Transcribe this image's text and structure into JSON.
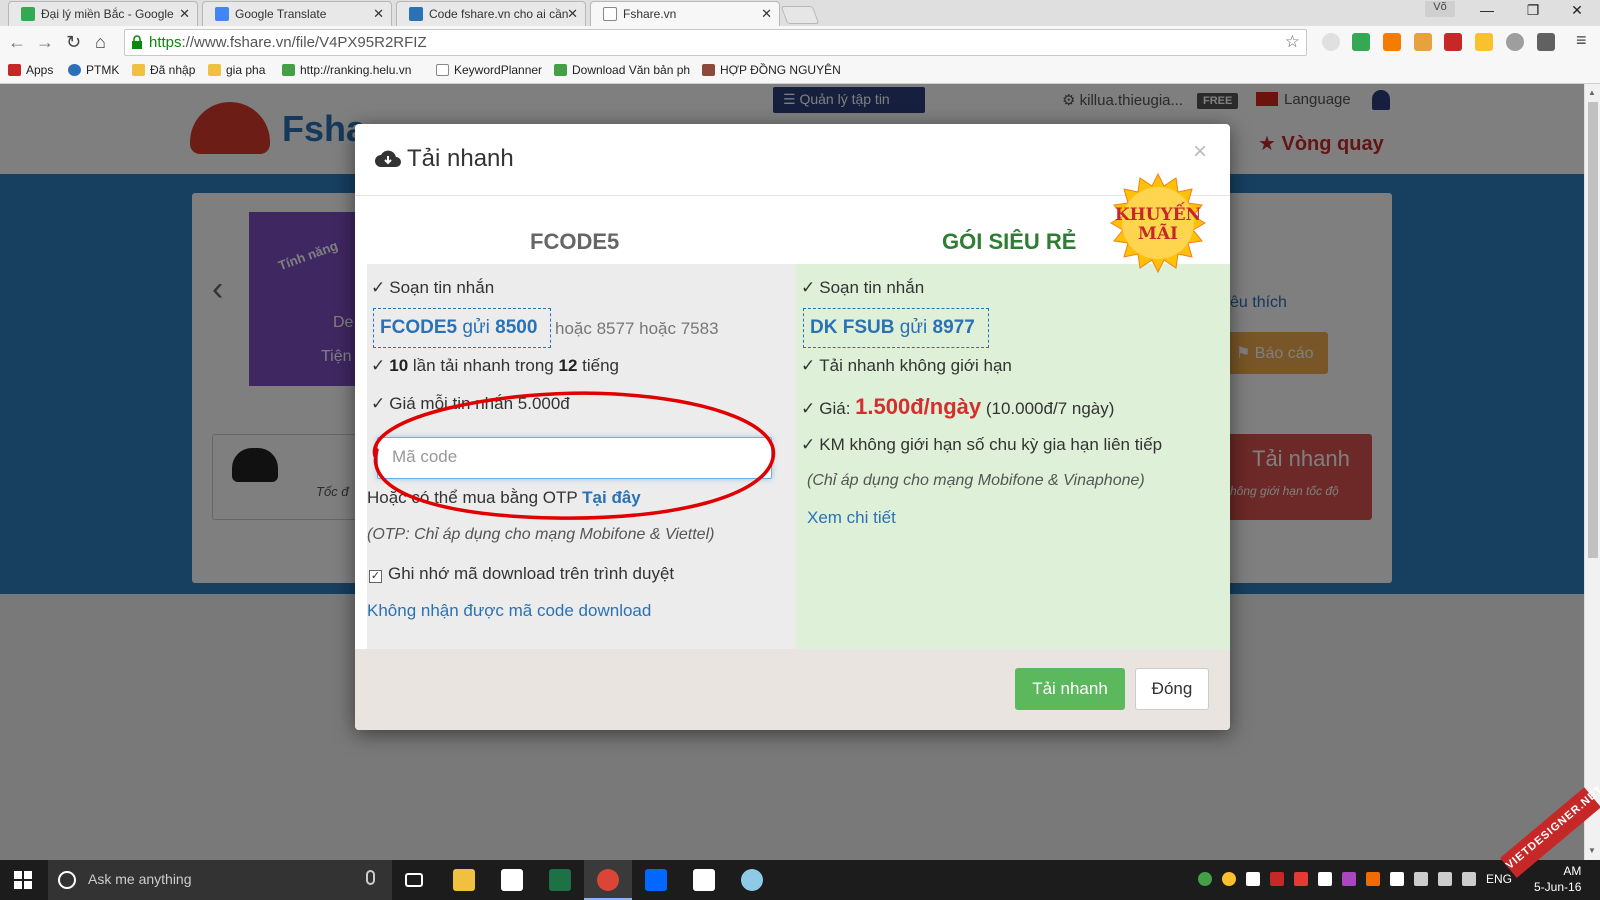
{
  "browser": {
    "tabs": [
      {
        "title": "Đại lý miền Bắc - Google",
        "favicon_color": "#34a853"
      },
      {
        "title": "Google Translate",
        "favicon_color": "#4285f4"
      },
      {
        "title": "Code fshare.vn cho ai cần",
        "favicon_color": "#2a72b5"
      },
      {
        "title": "Fshare.vn",
        "favicon_color": "#ffffff"
      }
    ],
    "user_chip": "Võ",
    "url_scheme": "https",
    "url_rest": "://www.fshare.vn/file/V4PX95R2RFIZ",
    "bookmarks": [
      "Apps",
      "PTMK",
      "Đã nhập",
      "gia pha",
      "http://ranking.helu.vn",
      "KeywordPlanner",
      "Download Văn bản ph",
      "HỢP ĐỒNG NGUYÊN"
    ]
  },
  "site": {
    "logo_text": "Fsha",
    "manage_files": "☰ Quản lý tập tin",
    "username": "killua.thieugia...",
    "plan_badge": "FREE",
    "language": "Language",
    "spin": "★ Vòng quay",
    "favorite_link": "êu thích",
    "report_button": "⚑ Báo cáo",
    "fast_download": "Tải nhanh",
    "fast_download_sub": "hông giới hạn tốc độ",
    "speed_text": "Tốc đ",
    "banner_text_1": "Tính năng",
    "banner_text_2": "De",
    "banner_text_3": "Tiện"
  },
  "modal": {
    "title": "Tải nhanh",
    "close": "×",
    "promo_line1": "KHUYẾN",
    "promo_line2": "MÃI",
    "left": {
      "heading": "FCODE5",
      "item1": "Soạn tin nhắn",
      "code": "FCODE5",
      "code_send": "gửi",
      "code_number": "8500",
      "alt_numbers": "hoặc 8577 hoặc 7583",
      "limit_count": "10",
      "limit_text_a": "lần tải nhanh trong",
      "limit_hours": "12",
      "limit_text_b": "tiếng",
      "price_line": "Giá mỗi tin nhắn 5.000đ",
      "input_placeholder": "Mã code",
      "otp_text": "Hoặc có thể mua bằng OTP",
      "otp_link": "Tại đây",
      "otp_note": "(OTP: Chỉ áp dụng cho mạng Mobifone & Viettel)",
      "remember": "Ghi nhớ mã download trên trình duyệt",
      "remember_checked": true,
      "no_code_link": "Không nhận được mã code download"
    },
    "right": {
      "heading": "GÓI SIÊU RẺ",
      "item1": "Soạn tin nhắn",
      "code": "DK FSUB",
      "code_send": "gửi",
      "code_number": "8977",
      "item2": "Tải nhanh không giới hạn",
      "price_label": "Giá:",
      "price": "1.500đ/ngày",
      "price_week": "(10.000đ/7 ngày)",
      "item4": "KM không giới hạn số chu kỳ gia hạn liên tiếp",
      "note": "(Chỉ áp dụng cho mạng Mobifone & Vinaphone)",
      "details_link": "Xem chi tiết"
    },
    "footer": {
      "primary": "Tải nhanh",
      "secondary": "Đóng"
    }
  },
  "taskbar": {
    "search_placeholder": "Ask me anything",
    "language": "ENG",
    "time": "AM",
    "date": "5-Jun-16",
    "watermark": "VIETDESIGNER.NET"
  },
  "colors": {
    "accent_blue": "#2a72b5",
    "green": "#5cb85c",
    "promo_red": "#c62828",
    "annotation_red": "#e00000"
  }
}
